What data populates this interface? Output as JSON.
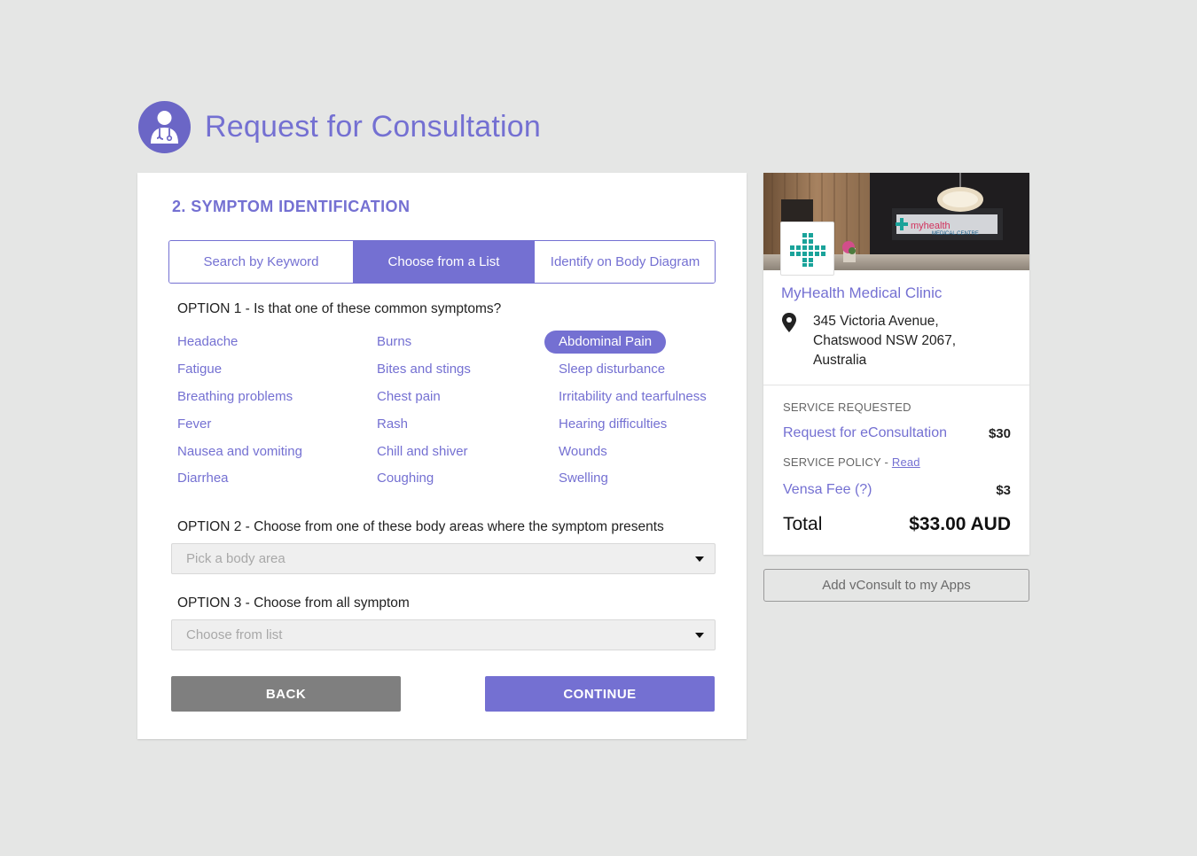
{
  "header": {
    "title": "Request for Consultation",
    "icon": "doctor-icon"
  },
  "colors": {
    "accent": "#7470d2",
    "background": "#e5e6e5",
    "back_button": "#7f7f7f",
    "clinic_teal": "#1aa39a"
  },
  "main": {
    "section_title": "2. SYMPTOM IDENTIFICATION",
    "tabs": [
      {
        "label": "Search by Keyword",
        "active": false
      },
      {
        "label": "Choose from a List",
        "active": true
      },
      {
        "label": "Identify on Body Diagram",
        "active": false
      }
    ],
    "option1": {
      "label": "OPTION 1 - Is that one of these common symptoms?",
      "symptoms": [
        [
          "Headache",
          "Fatigue",
          "Breathing problems",
          "Fever",
          "Nausea and vomiting",
          "Diarrhea"
        ],
        [
          "Burns",
          "Bites and stings",
          "Chest pain",
          "Rash",
          "Chill and shiver",
          "Coughing"
        ],
        [
          "Abdominal Pain",
          "Sleep disturbance",
          "Irritability and tearfulness",
          "Hearing difficulties",
          "Wounds",
          "Swelling"
        ]
      ],
      "selected": "Abdominal Pain"
    },
    "option2": {
      "label": "OPTION 2 - Choose from one of these body areas where the symptom presents",
      "placeholder": "Pick a body area"
    },
    "option3": {
      "label": "OPTION 3 - Choose from all symptom",
      "placeholder": "Choose from list"
    },
    "back_label": "BACK",
    "continue_label": "CONTINUE"
  },
  "sidebar": {
    "clinic_name": "MyHealth Medical Clinic",
    "address_lines": [
      "345 Victoria Avenue,",
      "Chatswood NSW 2067,",
      "Australia"
    ],
    "photo_sign": "myhealth",
    "photo_sign_sub": "MEDICAL CENTRE",
    "service_requested_label": "SERVICE REQUESTED",
    "service_name": "Request for eConsultation",
    "service_price": "$30",
    "service_policy_label": "SERVICE POLICY -",
    "service_policy_link": "Read",
    "fee_name": "Vensa Fee (?)",
    "fee_price": "$3",
    "total_label": "Total",
    "total_value": "$33.00 AUD",
    "add_apps_label": "Add vConsult to my Apps"
  }
}
